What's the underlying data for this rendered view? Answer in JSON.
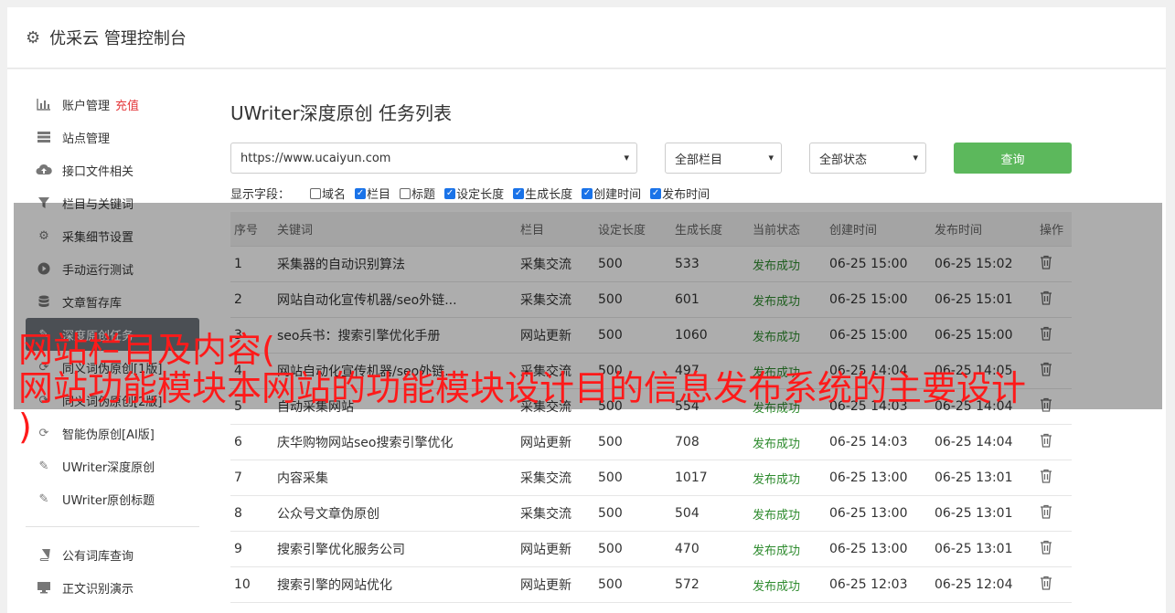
{
  "header": {
    "title": "优采云 管理控制台"
  },
  "sidebar": {
    "items": [
      {
        "label": "账户管理",
        "badge": "充值",
        "icon": "bar-chart-icon"
      },
      {
        "label": "站点管理",
        "icon": "server-icon"
      },
      {
        "label": "接口文件相关",
        "icon": "cloud-upload-icon"
      },
      {
        "label": "栏目与关键词",
        "icon": "filter-icon"
      },
      {
        "label": "采集细节设置",
        "icon": "gears-icon"
      },
      {
        "label": "手动运行测试",
        "icon": "play-circle-icon"
      },
      {
        "label": "文章暂存库",
        "icon": "database-icon"
      },
      {
        "label": "深度原创任务",
        "icon": "edit-icon",
        "active": true
      },
      {
        "label": "同义词伪原创[1版]",
        "icon": "refresh-icon"
      },
      {
        "label": "同义词伪原创[2版]",
        "icon": "refresh-icon"
      },
      {
        "label": "智能伪原创[AI版]",
        "icon": "refresh-icon"
      },
      {
        "label": "UWriter深度原创",
        "icon": "edit-icon"
      },
      {
        "label": "UWriter原创标题",
        "icon": "edit-icon"
      }
    ],
    "items2": [
      {
        "label": "公有词库查询",
        "icon": "book-icon"
      },
      {
        "label": "正文识别演示",
        "icon": "monitor-icon"
      }
    ]
  },
  "page": {
    "title": "UWriter深度原创 任务列表",
    "site_select": "https://www.ucaiyun.com",
    "column_select": "全部栏目",
    "status_select": "全部状态",
    "query_label": "查询",
    "fields_label": "显示字段：",
    "fields": [
      {
        "label": "域名",
        "checked": false
      },
      {
        "label": "栏目",
        "checked": true
      },
      {
        "label": "标题",
        "checked": false
      },
      {
        "label": "设定长度",
        "checked": true
      },
      {
        "label": "生成长度",
        "checked": true
      },
      {
        "label": "创建时间",
        "checked": true
      },
      {
        "label": "发布时间",
        "checked": true
      }
    ]
  },
  "table": {
    "headers": [
      "序号",
      "关键词",
      "栏目",
      "设定长度",
      "生成长度",
      "当前状态",
      "创建时间",
      "发布时间",
      "操作"
    ],
    "rows": [
      [
        "1",
        "采集器的自动识别算法",
        "采集交流",
        "500",
        "533",
        "发布成功",
        "06-25 15:00",
        "06-25 15:02"
      ],
      [
        "2",
        "网站自动化宣传机器/seo外链...",
        "采集交流",
        "500",
        "601",
        "发布成功",
        "06-25 15:00",
        "06-25 15:01"
      ],
      [
        "3",
        "seo兵书：搜索引擎优化手册",
        "网站更新",
        "500",
        "1060",
        "发布成功",
        "06-25 15:00",
        "06-25 15:00"
      ],
      [
        "4",
        "网站自动化宣传机器/seo外链...",
        "采集交流",
        "500",
        "497",
        "发布成功",
        "06-25 14:04",
        "06-25 14:05"
      ],
      [
        "5",
        "自动采集网站",
        "采集交流",
        "500",
        "554",
        "发布成功",
        "06-25 14:03",
        "06-25 14:04"
      ],
      [
        "6",
        "庆华购物网站seo搜索引擎优化",
        "网站更新",
        "500",
        "708",
        "发布成功",
        "06-25 14:03",
        "06-25 14:04"
      ],
      [
        "7",
        "内容采集",
        "采集交流",
        "500",
        "1017",
        "发布成功",
        "06-25 13:00",
        "06-25 13:01"
      ],
      [
        "8",
        "公众号文章伪原创",
        "采集交流",
        "500",
        "504",
        "发布成功",
        "06-25 13:00",
        "06-25 13:01"
      ],
      [
        "9",
        "搜索引擎优化服务公司",
        "网站更新",
        "500",
        "470",
        "发布成功",
        "06-25 13:00",
        "06-25 13:01"
      ],
      [
        "10",
        "搜索引擎的网站优化",
        "网站更新",
        "500",
        "572",
        "发布成功",
        "06-25 12:03",
        "06-25 12:04"
      ]
    ]
  },
  "overlay": {
    "line1": "网站栏目及内容(",
    "line2": "网站功能模块本网站的功能模块设计目的信息发布系统的主要设计",
    "line3": ")"
  },
  "colors": {
    "accent_green": "#5cb85c",
    "status_green": "#2e8b2e",
    "badge_red": "#e4393c",
    "overlay_red": "#ff1a1a"
  }
}
